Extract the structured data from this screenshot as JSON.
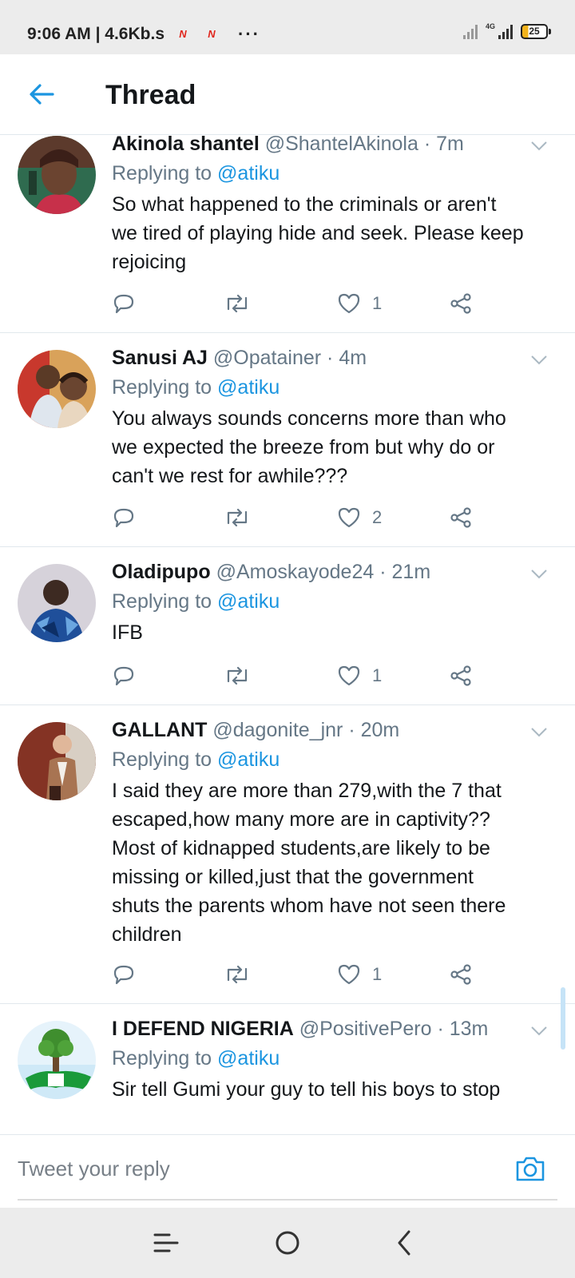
{
  "status_bar": {
    "time": "9:06 AM",
    "speed": "4.6Kb.s",
    "net_label": "4G",
    "battery": "25",
    "more": "···"
  },
  "header": {
    "title": "Thread"
  },
  "tweets": [
    {
      "name": "Akinola shantel",
      "handle": "@ShantelAkinola",
      "time": "7m",
      "replying_label": "Replying to",
      "mention": "@atiku",
      "lines": [
        "So what happened to the criminals or aren't",
        "we tired of playing hide and seek. Please keep",
        "rejoicing"
      ],
      "likes": "1"
    },
    {
      "name": "Sanusi AJ",
      "handle": "@Opatainer",
      "time": "4m",
      "replying_label": "Replying to",
      "mention": "@atiku",
      "lines": [
        "You always sounds concerns more than who",
        "we expected the breeze from but why do or",
        "can't we rest for awhile???"
      ],
      "likes": "2"
    },
    {
      "name": "Oladipupo",
      "handle": "@Amoskayode24",
      "time": "21m",
      "replying_label": "Replying to",
      "mention": "@atiku",
      "lines": [
        "IFB"
      ],
      "likes": "1"
    },
    {
      "name": "GALLANT",
      "handle": "@dagonite_jnr",
      "time": "20m",
      "replying_label": "Replying to",
      "mention": "@atiku",
      "lines": [
        "I said they are more than 279,with the 7 that",
        "escaped,how many more are in captivity??",
        "Most of kidnapped students,are likely to be",
        "missing or killed,just that the government",
        "shuts the parents whom have not seen there",
        "children"
      ],
      "likes": "1"
    },
    {
      "name": "I DEFEND NIGERIA",
      "handle": "@PositivePero",
      "time": "13m",
      "replying_label": "Replying to",
      "mention": "@atiku",
      "lines": [
        "Sir tell Gumi your guy to tell his boys to stop"
      ],
      "likes": ""
    }
  ],
  "reply_bar": {
    "placeholder": "Tweet your reply"
  },
  "colors": {
    "accent": "#1b95e0",
    "muted": "#657786",
    "divider": "#e1e8ed"
  }
}
